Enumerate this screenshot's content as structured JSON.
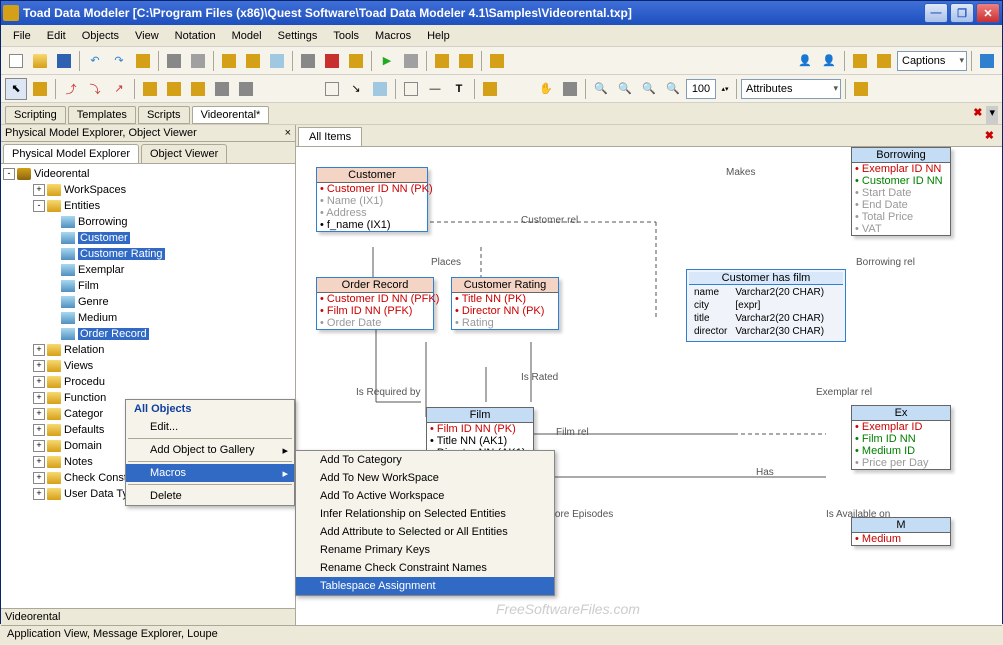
{
  "title": "Toad Data Modeler  [C:\\Program Files (x86)\\Quest Software\\Toad Data Modeler 4.1\\Samples\\Videorental.txp]",
  "menubar": [
    "File",
    "Edit",
    "Objects",
    "View",
    "Notation",
    "Model",
    "Settings",
    "Tools",
    "Macros",
    "Help"
  ],
  "toolbar1": {
    "zoom": "100",
    "dropdown1": "Captions",
    "dropdown2": "Attributes"
  },
  "fileTabs": [
    "Scripting",
    "Templates",
    "Scripts",
    "Videorental*"
  ],
  "leftPanel": {
    "title": "Physical Model Explorer, Object Viewer",
    "tabs": [
      "Physical Model Explorer",
      "Object Viewer"
    ],
    "footer": "Videorental"
  },
  "docTabs": [
    "All Items"
  ],
  "tree": {
    "root": "Videorental",
    "nodes": [
      {
        "label": "WorkSpaces",
        "type": "folder",
        "indent": 1,
        "toggle": "+"
      },
      {
        "label": "Entities",
        "type": "folder",
        "indent": 1,
        "toggle": "-",
        "expanded": true
      },
      {
        "label": "Borrowing",
        "type": "table",
        "indent": 2
      },
      {
        "label": "Customer",
        "type": "table",
        "indent": 2,
        "selected": true
      },
      {
        "label": "Customer Rating",
        "type": "table",
        "indent": 2,
        "selected": true
      },
      {
        "label": "Exemplar",
        "type": "table",
        "indent": 2
      },
      {
        "label": "Film",
        "type": "table",
        "indent": 2
      },
      {
        "label": "Genre",
        "type": "table",
        "indent": 2
      },
      {
        "label": "Medium",
        "type": "table",
        "indent": 2
      },
      {
        "label": "Order Record",
        "type": "table",
        "indent": 2,
        "selected": true
      },
      {
        "label": "Relation",
        "type": "folder",
        "indent": 1,
        "toggle": "+"
      },
      {
        "label": "Views",
        "type": "folder",
        "indent": 1,
        "toggle": "+"
      },
      {
        "label": "Procedu",
        "type": "folder",
        "indent": 1,
        "toggle": "+"
      },
      {
        "label": "Function",
        "type": "folder",
        "indent": 1,
        "toggle": "+"
      },
      {
        "label": "Categor",
        "type": "folder",
        "indent": 1,
        "toggle": "+"
      },
      {
        "label": "Defaults",
        "type": "folder",
        "indent": 1,
        "toggle": "+"
      },
      {
        "label": "Domain",
        "type": "folder",
        "indent": 1,
        "toggle": "+"
      },
      {
        "label": "Notes",
        "type": "folder",
        "indent": 1,
        "toggle": "+"
      },
      {
        "label": "Check Constraint Rules",
        "type": "folder",
        "indent": 1,
        "toggle": "+"
      },
      {
        "label": "User Data Types",
        "type": "folder",
        "indent": 1,
        "toggle": "+"
      }
    ]
  },
  "contextMenu1": {
    "heading": "All Objects",
    "items": [
      "Edit...",
      "Add Object to Gallery",
      "Macros",
      "Delete"
    ],
    "hover": "Macros"
  },
  "contextMenu2": {
    "items": [
      "Add To Category",
      "Add To New WorkSpace",
      "Add To Active Workspace",
      "Infer Relationship on Selected Entities",
      "Add Attribute to Selected or All Entities",
      "Rename Primary Keys",
      "Rename Check Constraint Names",
      "Tablespace Assignment"
    ],
    "hover": "Tablespace Assignment"
  },
  "entities": {
    "customer": {
      "title": "Customer",
      "rows": [
        {
          "t": "Customer ID NN  (PK)",
          "c": "pk"
        },
        {
          "t": "Name  (IX1)",
          "c": "gray"
        },
        {
          "t": "Address",
          "c": "gray"
        },
        {
          "t": "f_name (IX1)",
          "c": ""
        }
      ]
    },
    "orderRecord": {
      "title": "Order Record",
      "rows": [
        {
          "t": "Customer ID NN  (PFK)",
          "c": "pk"
        },
        {
          "t": "Film ID NN  (PFK)",
          "c": "pk"
        },
        {
          "t": "Order Date",
          "c": "gray"
        }
      ]
    },
    "customerRating": {
      "title": "Customer Rating",
      "rows": [
        {
          "t": "Title NN  (PK)",
          "c": "pk"
        },
        {
          "t": "Director NN  (PK)",
          "c": "pk"
        },
        {
          "t": "Rating",
          "c": "gray"
        }
      ]
    },
    "film": {
      "title": "Film",
      "rows": [
        {
          "t": "Film ID NN  (PK)",
          "c": "pk"
        },
        {
          "t": "Title NN (AK1)",
          "c": ""
        },
        {
          "t": "Director NN (AK1)",
          "c": ""
        }
      ]
    },
    "borrowing": {
      "title": "Borrowing",
      "rows": [
        {
          "t": "Exemplar ID NN",
          "c": "pk"
        },
        {
          "t": "Customer ID NN",
          "c": "nn"
        },
        {
          "t": "Start Date",
          "c": "gray"
        },
        {
          "t": "End Date",
          "c": "gray"
        },
        {
          "t": "Total Price",
          "c": "gray"
        },
        {
          "t": "VAT",
          "c": "gray"
        }
      ]
    },
    "ex": {
      "title": "Ex",
      "rows": [
        {
          "t": "Exemplar ID",
          "c": "pk"
        },
        {
          "t": "Film ID NN",
          "c": "nn"
        },
        {
          "t": "Medium ID",
          "c": "nn"
        },
        {
          "t": "Price per Day",
          "c": "gray"
        }
      ]
    },
    "m": {
      "title": "M",
      "rows": [
        {
          "t": "Medium",
          "c": "pk"
        }
      ]
    }
  },
  "view": {
    "title": "Customer has film",
    "rows": [
      [
        "name",
        "Varchar2(20 CHAR)"
      ],
      [
        "city",
        "[expr]"
      ],
      [
        "title",
        "Varchar2(20 CHAR)"
      ],
      [
        "director",
        "Varchar2(30 CHAR)"
      ]
    ]
  },
  "relLabels": {
    "makes": "Makes",
    "customerRel": "Customer rel",
    "places": "Places",
    "isRated": "Is Rated",
    "isRequired": "Is Required by",
    "filmRel": "Film rel",
    "has": "Has",
    "hasMore": "Has More Episodes",
    "exemplarRel": "Exemplar rel",
    "borrowingRel": "Borrowing rel",
    "isAvailable": "Is Available on"
  },
  "statusbar": "Application View, Message Explorer, Loupe",
  "watermark": "FreeSoftwareFiles.com"
}
